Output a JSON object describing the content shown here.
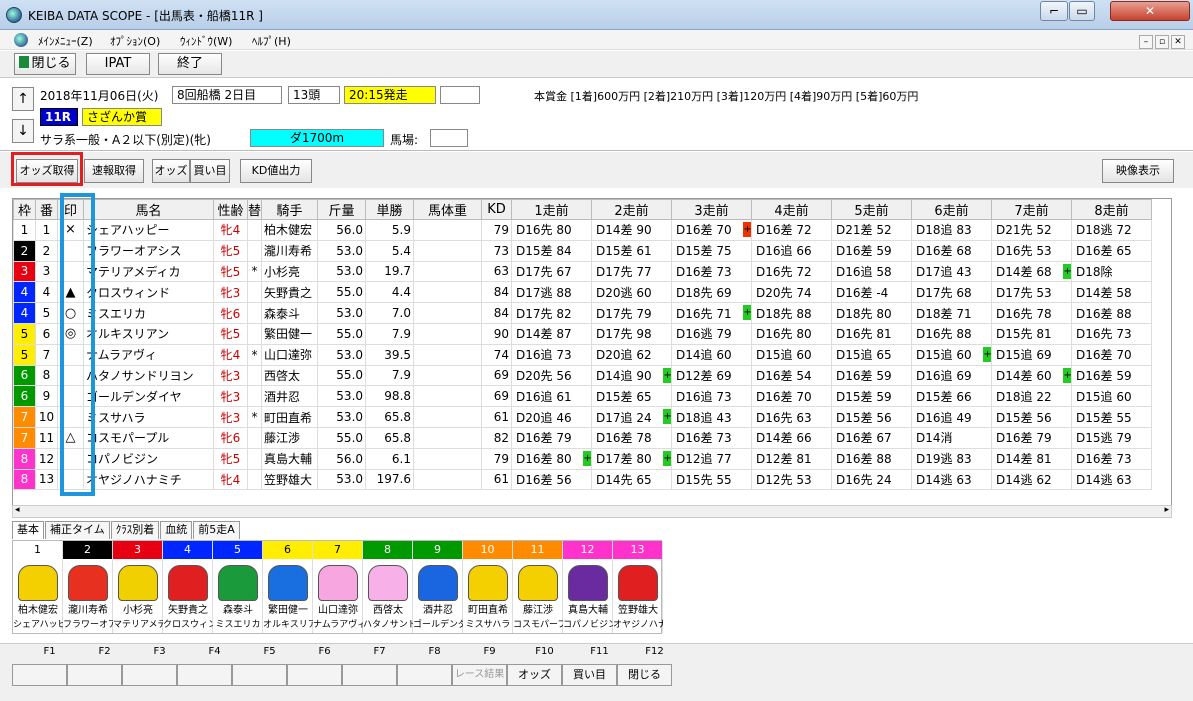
{
  "window": {
    "title": "KEIBA DATA SCOPE - [出馬表・船橋11R ]",
    "min_label": "⌐",
    "max_label": "▭",
    "close_label": "✕"
  },
  "menu": {
    "items": [
      "ﾒｲﾝﾒﾆｭｰ(Z)",
      "ｵﾌﾟｼｮﾝ(O)",
      "ｳｨﾝﾄﾞｳ(W)",
      "ﾍﾙﾌﾟ(H)"
    ],
    "mdi": [
      "–",
      "▫",
      "✕"
    ]
  },
  "toolbar": {
    "close": "閉じる",
    "ipat": "IPAT",
    "exit": "終了"
  },
  "race": {
    "date": "2018年11月06日(火)",
    "meeting": "8回船橋 2日目",
    "heads": "13頭",
    "start": "20:15発走",
    "number": "11R",
    "name": "さざんか賞",
    "class": "サラ系一般・A２以下(別定)(牝)",
    "course": "ダ1700m",
    "track_label": "馬場:",
    "prize": "本賞金 [1着]600万円 [2着]210万円 [3着]120万円 [4着]90万円 [5着]60万円",
    "up": "↑",
    "down": "↓"
  },
  "subtoolbar": {
    "odds_get": "オッズ取得",
    "speed_get": "速報取得",
    "odds": "オッズ",
    "buy": "買い目",
    "kd_out": "KD値出力",
    "video": "映像表示"
  },
  "columns": [
    "枠",
    "番",
    "印",
    "馬名",
    "性齢",
    "替",
    "騎手",
    "斤量",
    "単勝",
    "馬体重",
    "KD",
    "1走前",
    "2走前",
    "3走前",
    "4走前",
    "5走前",
    "6走前",
    "7走前",
    "8走前"
  ],
  "colors": {
    "waku": [
      "#ffffff",
      "#000000",
      "#e60012",
      "#0026ff",
      "#0026ff",
      "#ffee00",
      "#ffee00",
      "#009900",
      "#009900",
      "#ff8c00",
      "#ff8c00",
      "#ff33cc",
      "#ff33cc"
    ],
    "plus_green": "#22cc22",
    "plus_red": "#ee3300"
  },
  "horses": [
    {
      "waku": "1",
      "num": "1",
      "mark": "×",
      "name": "シェアハッピー",
      "sex": "牝4",
      "chg": "",
      "jockey": "柏木健宏",
      "weight": "56.0",
      "odds": "5.9",
      "bw": "",
      "kd": "79",
      "runs": [
        "D16先 80",
        "D14差 90",
        "D16差 70",
        "D16差 72",
        "D21差 52",
        "D18追 83",
        "D21先 52",
        "D18逃 72"
      ],
      "plus": [
        null,
        null,
        "red",
        null,
        null,
        null,
        null,
        null
      ]
    },
    {
      "waku": "2",
      "num": "2",
      "mark": "",
      "name": "フラワーオアシス",
      "sex": "牝5",
      "chg": "",
      "jockey": "瀧川寿希",
      "weight": "53.0",
      "odds": "5.4",
      "bw": "",
      "kd": "73",
      "runs": [
        "D15差 84",
        "D15差 61",
        "D15差 75",
        "D16追 66",
        "D16差 59",
        "D16差 68",
        "D16先 53",
        "D16差 65"
      ],
      "plus": [
        null,
        null,
        null,
        null,
        null,
        null,
        null,
        null
      ]
    },
    {
      "waku": "3",
      "num": "3",
      "mark": "",
      "name": "マテリアメディカ",
      "sex": "牝5",
      "chg": "*",
      "jockey": "小杉亮",
      "weight": "53.0",
      "odds": "19.7",
      "bw": "",
      "kd": "63",
      "runs": [
        "D17先 67",
        "D17先 77",
        "D16差 73",
        "D16先 72",
        "D16追 58",
        "D17追 43",
        "D14差 68",
        "D18除"
      ],
      "plus": [
        null,
        null,
        null,
        null,
        null,
        null,
        "green",
        null
      ]
    },
    {
      "waku": "4",
      "num": "4",
      "mark": "▲",
      "name": "クロスウィンド",
      "sex": "牝3",
      "chg": "",
      "jockey": "矢野貴之",
      "weight": "55.0",
      "odds": "4.4",
      "bw": "",
      "kd": "84",
      "runs": [
        "D17逃 88",
        "D20逃 60",
        "D18先 69",
        "D20先 74",
        "D16差 -4",
        "D17先 68",
        "D17先 53",
        "D14差 58"
      ],
      "plus": [
        null,
        null,
        null,
        null,
        null,
        null,
        null,
        null
      ]
    },
    {
      "waku": "4",
      "num": "5",
      "mark": "○",
      "name": "ミスエリカ",
      "sex": "牝6",
      "chg": "",
      "jockey": "森泰斗",
      "weight": "53.0",
      "odds": "7.0",
      "bw": "",
      "kd": "84",
      "runs": [
        "D17先 82",
        "D17先 79",
        "D16先 71",
        "D18先 88",
        "D18先 80",
        "D18差 71",
        "D16先 78",
        "D16差 88"
      ],
      "plus": [
        null,
        null,
        "green",
        null,
        null,
        null,
        null,
        null
      ]
    },
    {
      "waku": "5",
      "num": "6",
      "mark": "◎",
      "name": "オルキスリアン",
      "sex": "牝5",
      "chg": "",
      "jockey": "繁田健一",
      "weight": "55.0",
      "odds": "7.9",
      "bw": "",
      "kd": "90",
      "runs": [
        "D14差 87",
        "D17先 98",
        "D16逃 79",
        "D16先 80",
        "D16先 81",
        "D16先 88",
        "D15先 81",
        "D16先 73"
      ],
      "plus": [
        null,
        null,
        null,
        null,
        null,
        null,
        null,
        null
      ]
    },
    {
      "waku": "5",
      "num": "7",
      "mark": "",
      "name": "ナムラアヴィ",
      "sex": "牝4",
      "chg": "*",
      "jockey": "山口達弥",
      "weight": "53.0",
      "odds": "39.5",
      "bw": "",
      "kd": "74",
      "runs": [
        "D16追 73",
        "D20追 62",
        "D14追 60",
        "D15追 60",
        "D15追 65",
        "D15追 60",
        "D15追 69",
        "D16差 70"
      ],
      "plus": [
        null,
        null,
        null,
        null,
        null,
        "green",
        null,
        null
      ]
    },
    {
      "waku": "6",
      "num": "8",
      "mark": "",
      "name": "ハタノサンドリヨン",
      "sex": "牝3",
      "chg": "",
      "jockey": "西啓太",
      "weight": "55.0",
      "odds": "7.9",
      "bw": "",
      "kd": "69",
      "runs": [
        "D20先 56",
        "D14追 90",
        "D12差 69",
        "D16差 54",
        "D16差 59",
        "D16追 69",
        "D14差 60",
        "D16差 59"
      ],
      "plus": [
        null,
        "green",
        null,
        null,
        null,
        null,
        "green",
        null
      ]
    },
    {
      "waku": "6",
      "num": "9",
      "mark": "",
      "name": "ゴールデンダイヤ",
      "sex": "牝3",
      "chg": "",
      "jockey": "酒井忍",
      "weight": "53.0",
      "odds": "98.8",
      "bw": "",
      "kd": "69",
      "runs": [
        "D16追 61",
        "D15差 65",
        "D16追 73",
        "D16差 70",
        "D15差 59",
        "D15差 66",
        "D18追 22",
        "D15追 60"
      ],
      "plus": [
        null,
        null,
        null,
        null,
        null,
        null,
        null,
        null
      ]
    },
    {
      "waku": "7",
      "num": "10",
      "mark": "",
      "name": "ミスサハラ",
      "sex": "牝3",
      "chg": "*",
      "jockey": "町田直希",
      "weight": "53.0",
      "odds": "65.8",
      "bw": "",
      "kd": "61",
      "runs": [
        "D20追 46",
        "D17追 24",
        "D18追 43",
        "D16先 63",
        "D15差 56",
        "D16追 49",
        "D15差 56",
        "D15差 55"
      ],
      "plus": [
        null,
        "green",
        null,
        null,
        null,
        null,
        null,
        null
      ]
    },
    {
      "waku": "7",
      "num": "11",
      "mark": "△",
      "name": "コスモパープル",
      "sex": "牝6",
      "chg": "",
      "jockey": "藤江渉",
      "weight": "55.0",
      "odds": "65.8",
      "bw": "",
      "kd": "82",
      "runs": [
        "D16差 79",
        "D16差 78",
        "D16差 73",
        "D14差 66",
        "D16差 67",
        "D14消",
        "D16差 79",
        "D15逃 79"
      ],
      "plus": [
        null,
        null,
        null,
        null,
        null,
        null,
        null,
        null
      ]
    },
    {
      "waku": "8",
      "num": "12",
      "mark": "",
      "name": "コパノビジン",
      "sex": "牝5",
      "chg": "",
      "jockey": "真島大輔",
      "weight": "56.0",
      "odds": "6.1",
      "bw": "",
      "kd": "79",
      "runs": [
        "D16差 80",
        "D17差 80",
        "D12追 77",
        "D12差 81",
        "D16差 88",
        "D19逃 83",
        "D14差 81",
        "D16差 73"
      ],
      "plus": [
        "green",
        "green",
        null,
        null,
        null,
        null,
        null,
        null
      ]
    },
    {
      "waku": "8",
      "num": "13",
      "mark": "",
      "name": "オヤジノハナミチ",
      "sex": "牝4",
      "chg": "",
      "jockey": "笠野雄大",
      "weight": "53.0",
      "odds": "197.6",
      "bw": "",
      "kd": "61",
      "runs": [
        "D16差 56",
        "D14先 65",
        "D15先 55",
        "D12先 53",
        "D16先 24",
        "D14逃 63",
        "D14逃 62",
        "D14逃 63"
      ],
      "plus": [
        null,
        null,
        null,
        null,
        null,
        null,
        null,
        null
      ]
    }
  ],
  "tabs": [
    "基本",
    "補正タイム",
    "ｸﾗｽ別着",
    "血統",
    "前5走A"
  ],
  "silks": {
    "jockeys": [
      "柏木健宏",
      "瀧川寿希",
      "小杉亮",
      "矢野貴之",
      "森泰斗",
      "繁田健一",
      "山口達弥",
      "西啓太",
      "酒井忍",
      "町田直希",
      "藤江渉",
      "真島大輔",
      "笠野雄大"
    ],
    "horses": [
      "シェアハッピー",
      "フラワーオアシス",
      "マテリアメディカ",
      "クロスウィンド",
      "ミスエリカ",
      "オルキスリアン",
      "ナムラアヴィ",
      "ハタノサンドリヨン",
      "ゴールデンダイヤ",
      "ミスサハラ",
      "コスモパープル",
      "コパノビジン",
      "オヤジノハナミチ"
    ],
    "nums": [
      "1",
      "2",
      "3",
      "4",
      "5",
      "6",
      "7",
      "8",
      "9",
      "10",
      "11",
      "12",
      "13"
    ],
    "jersey_colors": [
      "#f5d000",
      "#e83020",
      "#f0d000",
      "#e02020",
      "#1a9a3a",
      "#1a6fe0",
      "#f7a6e0",
      "#f7b0e8",
      "#1a66e0",
      "#f5d000",
      "#f5d000",
      "#6a2aa0",
      "#e02020"
    ]
  },
  "fkeys": {
    "labels": [
      "F1",
      "F2",
      "F3",
      "F4",
      "F5",
      "F6",
      "F7",
      "F8",
      "F9",
      "F10",
      "F11",
      "F12"
    ],
    "buttons": [
      "",
      "",
      "",
      "",
      "",
      "",
      "",
      "",
      "レース結果",
      "オッズ",
      "買い目",
      "閉じる"
    ]
  }
}
